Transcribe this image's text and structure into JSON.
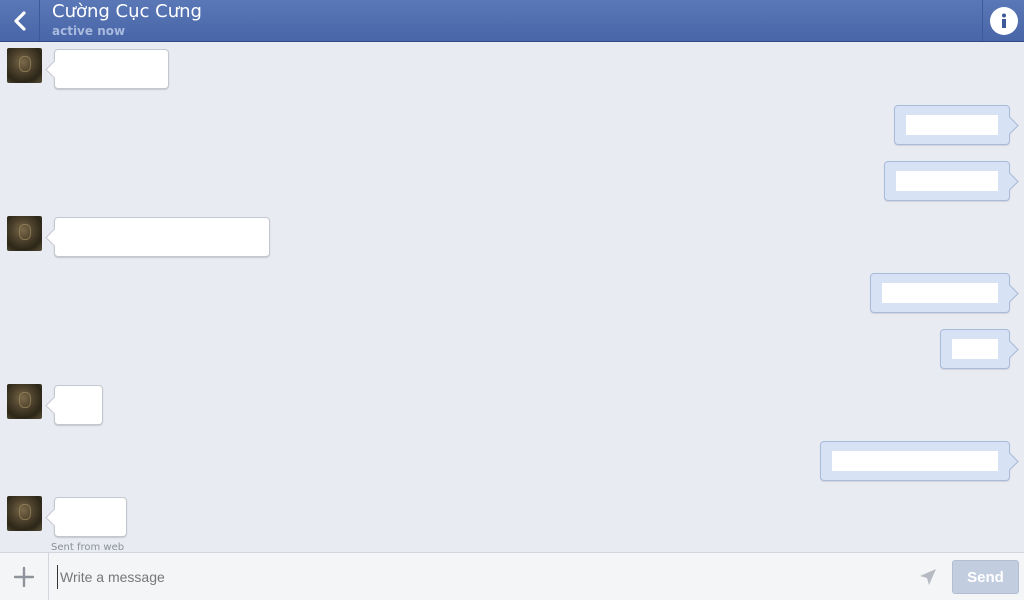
{
  "header": {
    "title": "Cường Cục Cưng",
    "status": "active now",
    "back_icon": "chevron-left-icon",
    "info_icon": "info-icon"
  },
  "conversation": {
    "messages": [
      {
        "direction": "incoming",
        "text": ""
      },
      {
        "direction": "outgoing",
        "text": ""
      },
      {
        "direction": "outgoing",
        "text": ""
      },
      {
        "direction": "incoming",
        "text": ""
      },
      {
        "direction": "outgoing",
        "text": ""
      },
      {
        "direction": "outgoing",
        "text": ""
      },
      {
        "direction": "incoming",
        "text": ""
      },
      {
        "direction": "outgoing",
        "text": ""
      },
      {
        "direction": "incoming",
        "text": ""
      }
    ],
    "sent_from": "Sent from web"
  },
  "composer": {
    "placeholder": "Write a message",
    "value": "",
    "send_label": "Send",
    "attach_icon": "plus-icon",
    "location_icon": "location-arrow-icon"
  },
  "colors": {
    "header_bg": "#4866a8",
    "incoming_bubble": "#ffffff",
    "outgoing_bubble": "#d7e3f5",
    "send_button": "#c3cde0"
  }
}
